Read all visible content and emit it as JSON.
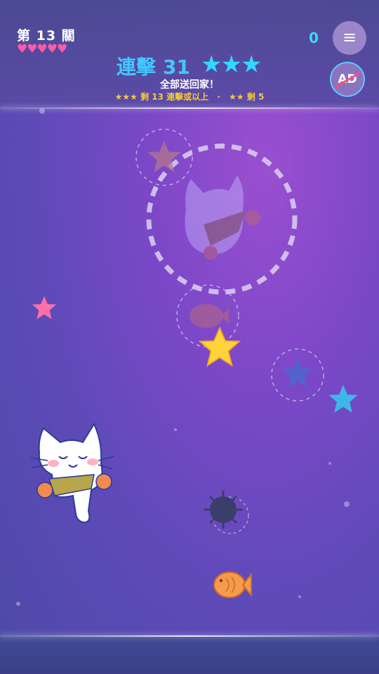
{
  "hud": {
    "level_text": "第 13 關",
    "hearts": "♥♥♥♥♥",
    "score": "0",
    "menu_icon": "≡",
    "noad_text": "AD"
  },
  "combo": {
    "label": "連擊",
    "count": "31",
    "stars": "★★★"
  },
  "objective": {
    "title": "全部送回家！",
    "three_star_stars": "★★★",
    "three_star_text": "剩 13 連擊或以上",
    "separator": "·",
    "two_star_stars": "★★",
    "two_star_text": "剩 5"
  },
  "colors": {
    "accent_cyan": "#41c8ff",
    "heart_pink": "#ff5aa8",
    "gold": "#f4c83c"
  }
}
